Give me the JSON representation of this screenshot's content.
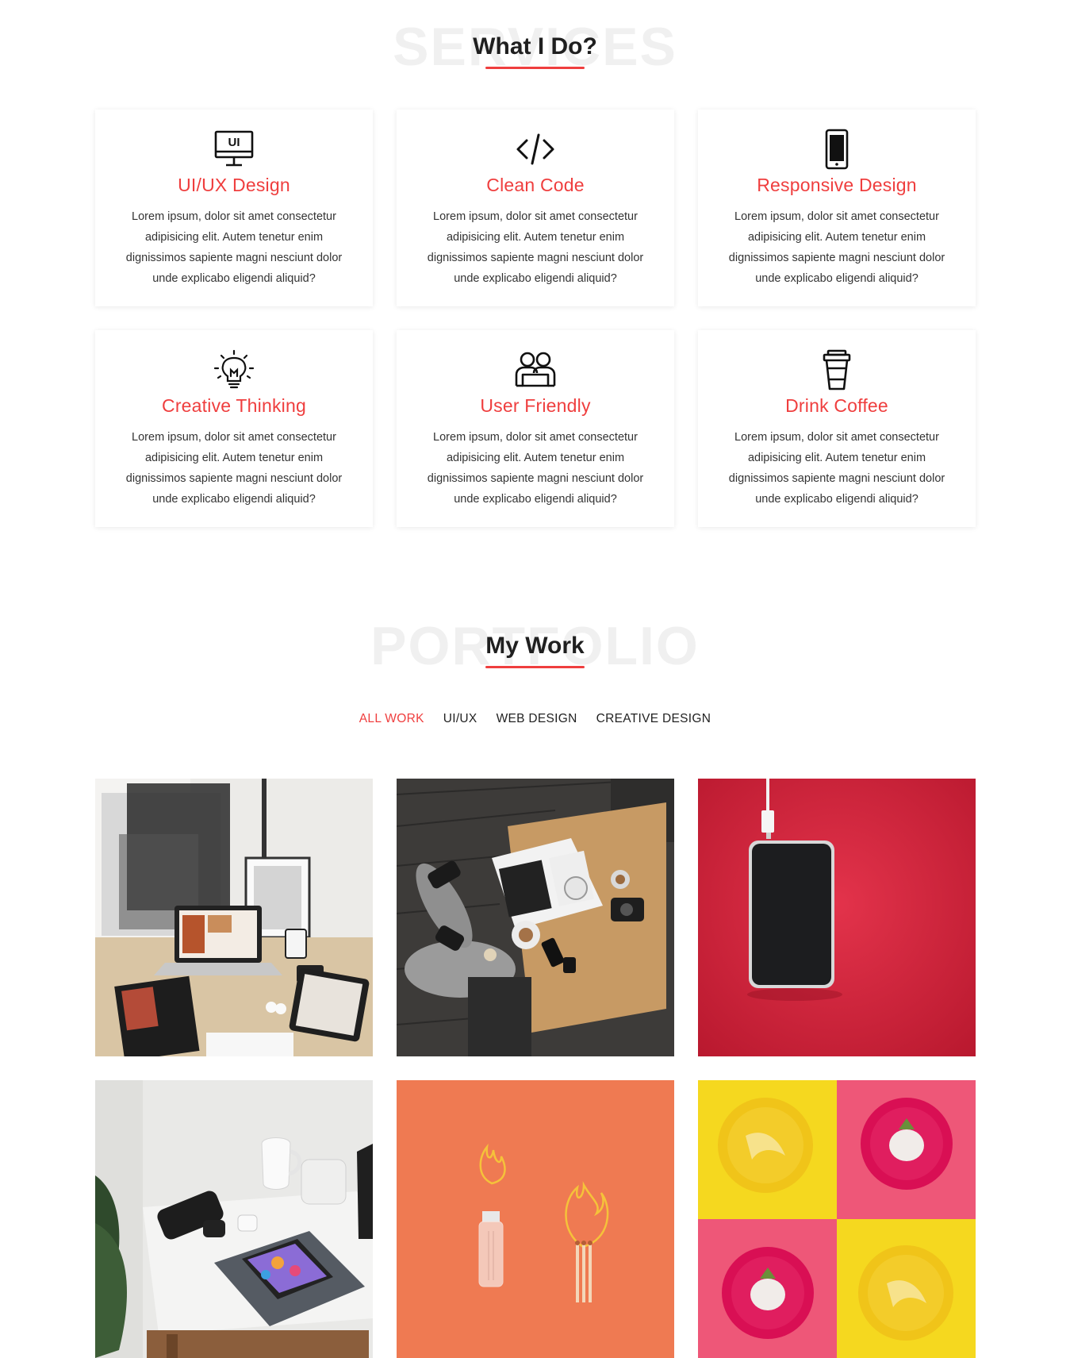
{
  "services": {
    "bg_word": "SERVICES",
    "title": "What I Do?",
    "items": [
      {
        "icon": "monitor-ui-icon",
        "title": "UI/UX Design",
        "icon_text": "UI",
        "text": "Lorem ipsum, dolor sit amet consectetur adipisicing elit. Autem tenetur enim dignissimos sapiente magni nesciunt dolor unde explicabo eligendi aliquid?"
      },
      {
        "icon": "code-icon",
        "title": "Clean Code",
        "text": "Lorem ipsum, dolor sit amet consectetur adipisicing elit. Autem tenetur enim dignissimos sapiente magni nesciunt dolor unde explicabo eligendi aliquid?"
      },
      {
        "icon": "smartphone-icon",
        "title": "Responsive Design",
        "text": "Lorem ipsum, dolor sit amet consectetur adipisicing elit. Autem tenetur enim dignissimos sapiente magni nesciunt dolor unde explicabo eligendi aliquid?"
      },
      {
        "icon": "lightbulb-icon",
        "title": "Creative Thinking",
        "text": "Lorem ipsum, dolor sit amet consectetur adipisicing elit. Autem tenetur enim dignissimos sapiente magni nesciunt dolor unde explicabo eligendi aliquid?"
      },
      {
        "icon": "users-icon",
        "title": "User Friendly",
        "text": "Lorem ipsum, dolor sit amet consectetur adipisicing elit. Autem tenetur enim dignissimos sapiente magni nesciunt dolor unde explicabo eligendi aliquid?"
      },
      {
        "icon": "coffee-cup-icon",
        "title": "Drink Coffee",
        "text": "Lorem ipsum, dolor sit amet consectetur adipisicing elit. Autem tenetur enim dignissimos sapiente magni nesciunt dolor unde explicabo eligendi aliquid?"
      }
    ]
  },
  "portfolio": {
    "bg_word": "PORTFOLIO",
    "title": "My Work",
    "filters": [
      "ALL WORK",
      "UI/UX",
      "WEB DESIGN",
      "CREATIVE DESIGN"
    ],
    "active_filter": "ALL WORK",
    "tiles": [
      "workspace-laptop-mockup-image",
      "coffee-table-magazine-image",
      "phone-on-red-image",
      "desk-phone-accessories-image",
      "lighter-and-matches-image",
      "fruit-plates-grid-image"
    ]
  },
  "colors": {
    "accent": "#ef3e3e",
    "bg_word": "#f0f0f0",
    "title": "#1f1f1f"
  }
}
